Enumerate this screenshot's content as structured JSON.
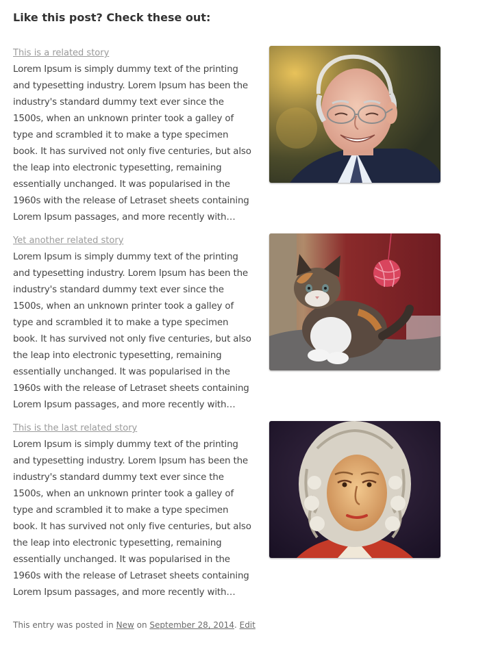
{
  "heading": "Like this post? Check these out:",
  "stories": [
    {
      "title": "This is a related story",
      "excerpt": "Lorem Ipsum is simply dummy text of the printing and typesetting industry. Lorem Ipsum has been the industry's standard dummy text ever since the 1500s, when an unknown printer took a galley of type and scrambled it to make a type specimen book. It has survived not only five centuries, but also the leap into electronic typesetting, remaining essentially unchanged. It was popularised in the 1960s with the release of Letraset sheets containing Lorem Ipsum passages, and more recently with…",
      "image": "photo-elderly-man-smiling"
    },
    {
      "title": "Yet another related story",
      "excerpt": "Lorem Ipsum is simply dummy text of the printing and typesetting industry. Lorem Ipsum has been the industry's standard dummy text ever since the 1500s, when an unknown printer took a galley of type and scrambled it to make a type specimen book. It has survived not only five centuries, but also the leap into electronic typesetting, remaining essentially unchanged. It was popularised in the 1960s with the release of Letraset sheets containing Lorem Ipsum passages, and more recently with…",
      "image": "photo-kitten-with-yarn-ball"
    },
    {
      "title": "This is the last related story",
      "excerpt": "Lorem Ipsum is simply dummy text of the printing and typesetting industry. Lorem Ipsum has been the industry's standard dummy text ever since the 1500s, when an unknown printer took a galley of type and scrambled it to make a type specimen book. It has survived not only five centuries, but also the leap into electronic typesetting, remaining essentially unchanged. It was popularised in the 1960s with the release of Letraset sheets containing Lorem Ipsum passages, and more recently with…",
      "image": "painting-man-in-white-wig"
    }
  ],
  "meta": {
    "prefix": "This entry was posted in ",
    "category": "New",
    "on": " on ",
    "date": "September 28, 2014",
    "separator": ". ",
    "edit": "Edit"
  }
}
